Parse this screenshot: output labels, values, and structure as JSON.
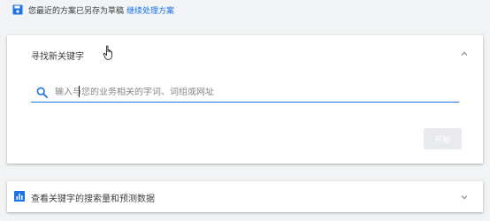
{
  "notice": {
    "text": "您最近的方案已另存为草稿",
    "link": "继续处理方案"
  },
  "find_keywords": {
    "title": "寻找新关键字",
    "search_placeholder": "输入与您的业务相关的字词、词组或网址",
    "start_button": "开始"
  },
  "forecast": {
    "title": "查看关键字的搜索量和预测数据"
  },
  "colors": {
    "accent": "#1a73e8",
    "background": "#f1f3f4",
    "disabled_button": "#e8eaed"
  },
  "icons": {
    "notice": "save-icon",
    "search": "search-icon",
    "forecast": "bar-chart-icon",
    "expand_collapse": "chevron-icon",
    "pointer": "hand-cursor-icon"
  }
}
